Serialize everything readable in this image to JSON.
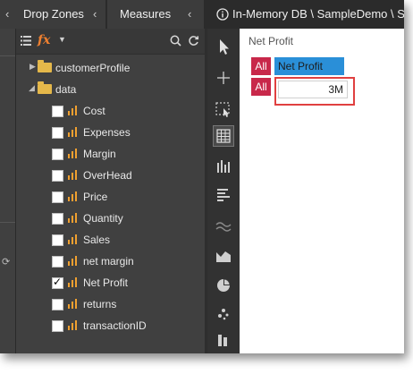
{
  "header": {
    "tab_drop_zones": "Drop Zones",
    "tab_measures": "Measures",
    "tab_report": "In-Memory DB \\ SampleDemo \\ S"
  },
  "toolbar": {
    "list_icon": "list-icon",
    "function_label": "fx",
    "dropdown_icon": "caret-down-icon",
    "search_icon": "search-icon",
    "refresh_icon": "refresh-icon"
  },
  "tree": {
    "folders": [
      {
        "label": "customerProfile",
        "expanded": false
      },
      {
        "label": "data",
        "expanded": true
      }
    ],
    "measures": [
      {
        "label": "Cost",
        "checked": false
      },
      {
        "label": "Expenses",
        "checked": false
      },
      {
        "label": "Margin",
        "checked": false
      },
      {
        "label": "OverHead",
        "checked": false
      },
      {
        "label": "Price",
        "checked": false
      },
      {
        "label": "Quantity",
        "checked": false
      },
      {
        "label": "Sales",
        "checked": false
      },
      {
        "label": "net margin",
        "checked": false
      },
      {
        "label": "Net Profit",
        "checked": true
      },
      {
        "label": "returns",
        "checked": false
      },
      {
        "label": "transactionID",
        "checked": false
      }
    ]
  },
  "visual_toolbar": [
    "pointer-icon",
    "crosshair-icon",
    "selection-icon",
    "grid-icon",
    "bar-chart-icon",
    "horizontal-bar-icon",
    "wave-icon",
    "area-chart-icon",
    "pie-chart-icon",
    "scatter-icon",
    "other-icon"
  ],
  "report": {
    "title": "Net Profit",
    "row_all_1": "All",
    "col_header": "Net Profit",
    "row_all_2": "All",
    "value": "3M"
  },
  "colors": {
    "all_red": "#c8284a",
    "header_blue": "#2a8fd8",
    "highlight_red": "#e04040",
    "measure_orange": "#f0a030"
  }
}
